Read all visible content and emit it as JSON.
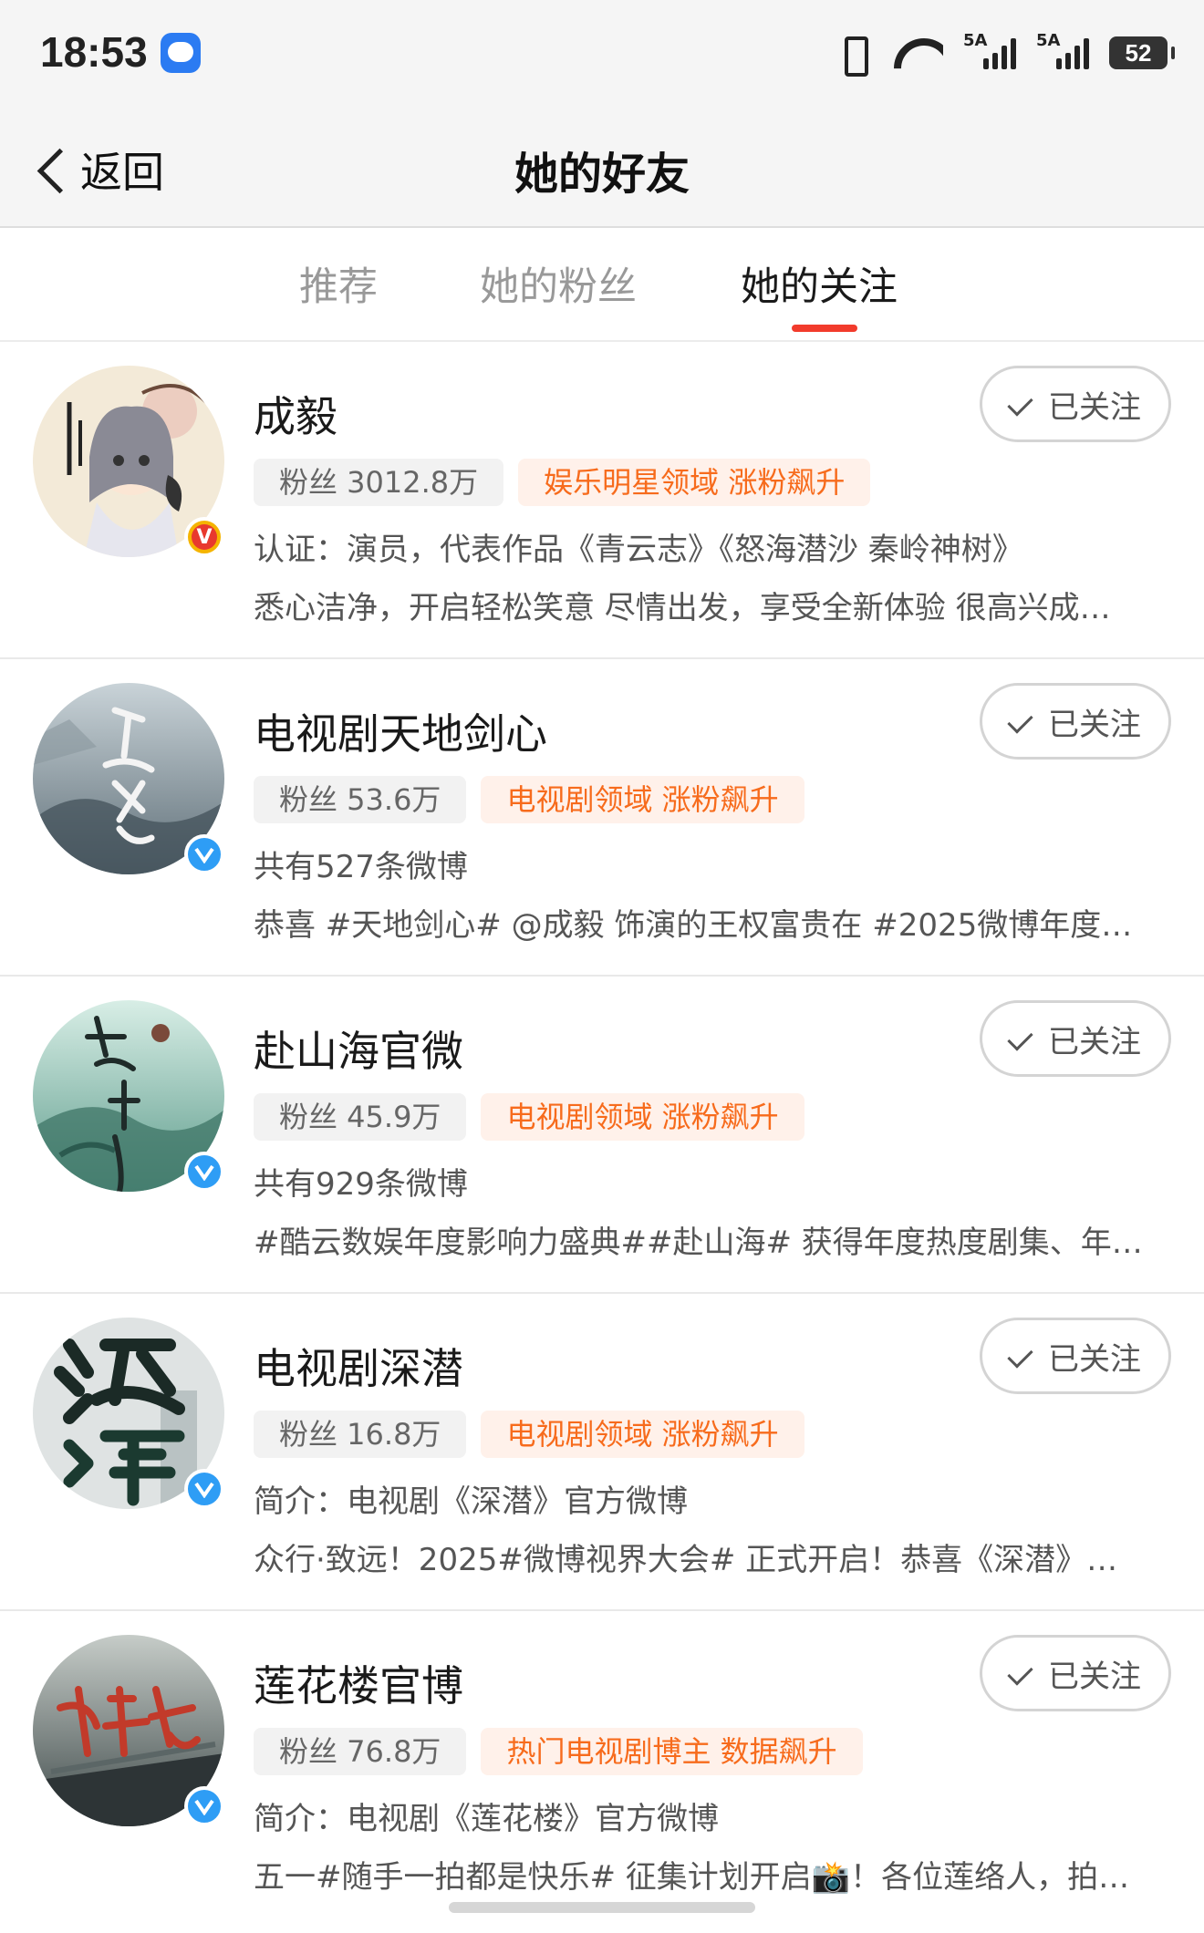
{
  "status_bar": {
    "time": "18:53",
    "signal1": "5A",
    "signal2": "5A",
    "battery": "52",
    "wifi_label": "6"
  },
  "header": {
    "back_label": "返回",
    "title": "她的好友"
  },
  "tabs": [
    {
      "label": "推荐",
      "active": false
    },
    {
      "label": "她的粉丝",
      "active": false
    },
    {
      "label": "她的关注",
      "active": true
    }
  ],
  "colors": {
    "accent": "#f23b2c",
    "tag_orange": "#f76b1c",
    "verify_blue": "#2e9df5",
    "verify_gold": "#f5b400"
  },
  "users": [
    {
      "name": "成毅",
      "fans": "粉丝 3012.8万",
      "domain": "娱乐明星领域 涨粉飙升",
      "desc": "认证：演员，代表作品《青云志》《怒海潜沙 秦岭神树》",
      "latest": "悉心洁净，开启轻松笑意 尽情出发，享受全新体验 很高兴成…",
      "follow_label": "已关注",
      "badge": "gold",
      "badge_text": "V"
    },
    {
      "name": "电视剧天地剑心",
      "fans": "粉丝 53.6万",
      "domain": "电视剧领域 涨粉飙升",
      "desc": "共有527条微博",
      "latest": "恭喜 #天地剑心# @成毅 饰演的王权富贵在 #2025微博年度…",
      "follow_label": "已关注",
      "badge": "blue",
      "badge_text": ""
    },
    {
      "name": "赴山海官微",
      "fans": "粉丝 45.9万",
      "domain": "电视剧领域 涨粉飙升",
      "desc": "共有929条微博",
      "latest": "#酷云数娱年度影响力盛典##赴山海# 获得年度热度剧集、年…",
      "follow_label": "已关注",
      "badge": "blue",
      "badge_text": ""
    },
    {
      "name": "电视剧深潜",
      "fans": "粉丝 16.8万",
      "domain": "电视剧领域 涨粉飙升",
      "desc": "简介：电视剧《深潜》官方微博",
      "latest": "众行·致远！2025#微博视界大会# 正式开启！恭喜《深潜》…",
      "follow_label": "已关注",
      "badge": "blue",
      "badge_text": ""
    },
    {
      "name": "莲花楼官博",
      "fans": "粉丝 76.8万",
      "domain": "热门电视剧博主 数据飙升",
      "desc": "简介：电视剧《莲花楼》官方微博",
      "latest": "五一#随手一拍都是快乐# 征集计划开启📸！各位莲络人，拍…",
      "follow_label": "已关注",
      "badge": "blue",
      "badge_text": ""
    }
  ]
}
